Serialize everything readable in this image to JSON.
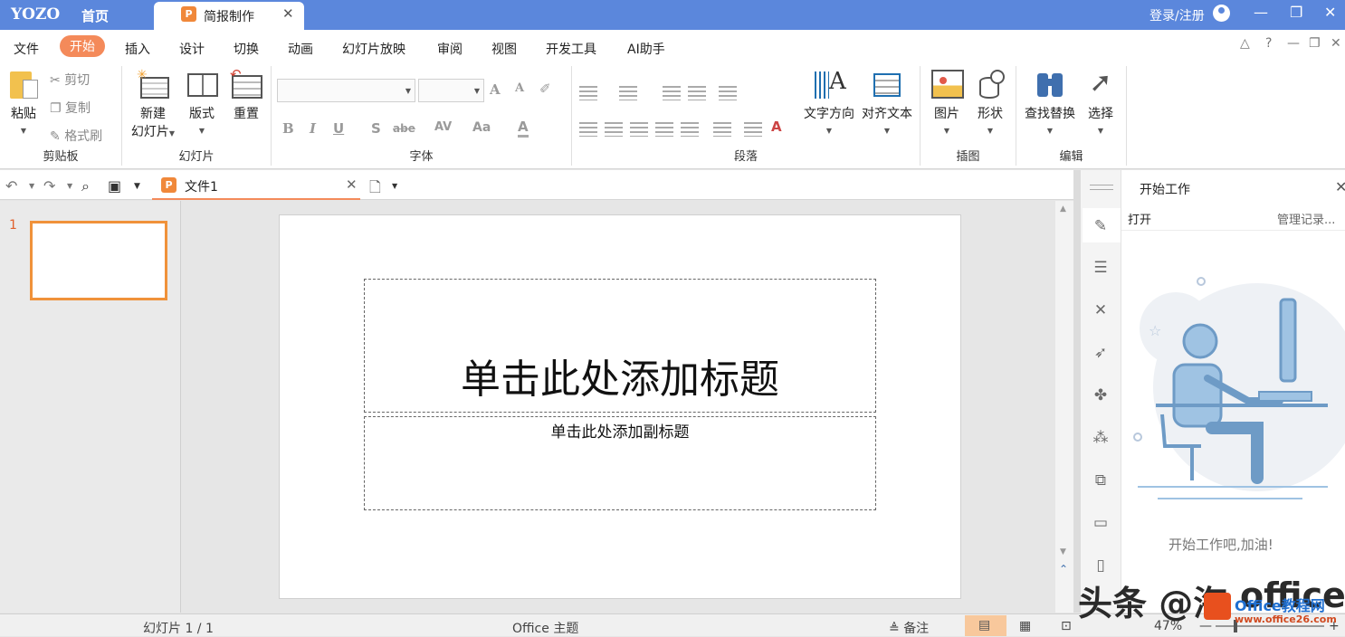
{
  "titlebar": {
    "logo": "YOZO",
    "home_label": "首页",
    "doc_tab_icon": "P",
    "doc_tab_label": "简报制作",
    "tab_close": "✕",
    "login_label": "登录/注册",
    "minimize": "—",
    "restore": "❐",
    "close": "✕"
  },
  "menu": {
    "items": [
      "文件",
      "开始",
      "插入",
      "设计",
      "切换",
      "动画",
      "幻灯片放映",
      "审阅",
      "视图",
      "开发工具",
      "AI助手"
    ],
    "active_index": 1,
    "right_icons": [
      "△",
      "?",
      "—",
      "❐",
      "✕"
    ]
  },
  "ribbon": {
    "clipboard": {
      "paste": "粘贴",
      "cut": "剪切",
      "copy": "复制",
      "format_painter": "格式刷",
      "group_label": "剪贴板"
    },
    "slides": {
      "new_slide_line1": "新建",
      "new_slide_line2": "幻灯片",
      "layout": "版式",
      "reset": "重置",
      "group_label": "幻灯片"
    },
    "font": {
      "font_name_value": "",
      "font_size_value": "",
      "bold": "B",
      "italic": "I",
      "underline": "U",
      "shadow": "S",
      "strikethrough": "abe",
      "spacing": "AV",
      "case": "Aa",
      "color": "A",
      "grow": "A",
      "shrink": "A",
      "group_label": "字体"
    },
    "paragraph": {
      "text_direction": "文字方向",
      "align_text": "对齐文本",
      "group_label": "段落"
    },
    "insert": {
      "picture": "图片",
      "shape": "形状",
      "group_label": "插图"
    },
    "edit": {
      "find_replace": "查找替换",
      "select": "选择",
      "group_label": "编辑"
    }
  },
  "quickbar": {
    "file_tab_icon": "P",
    "file_tab_label": "文件1",
    "file_tab_close": "✕"
  },
  "thumbnails": {
    "slide_number": "1"
  },
  "slide": {
    "title_placeholder": "单击此处添加标题",
    "subtitle_placeholder": "单击此处添加副标题"
  },
  "taskpane": {
    "title": "开始工作",
    "close": "✕",
    "open_label": "打开",
    "manage_label": "管理记录...",
    "message": "开始工作吧,加油!"
  },
  "statusbar": {
    "slide_counter": "幻灯片 1 / 1",
    "theme": "Office 主题",
    "notes": "备注",
    "zoom": "47%",
    "zoom_minus": "—",
    "zoom_plus": "+"
  },
  "watermark": {
    "text1": "头条 @海",
    "text2": "office",
    "site1": "Office教程网",
    "site2": "www.office26.com"
  },
  "colors": {
    "titlebar": "#5b87dc",
    "accent": "#f48a5a",
    "thumb_border": "#f0923a"
  }
}
